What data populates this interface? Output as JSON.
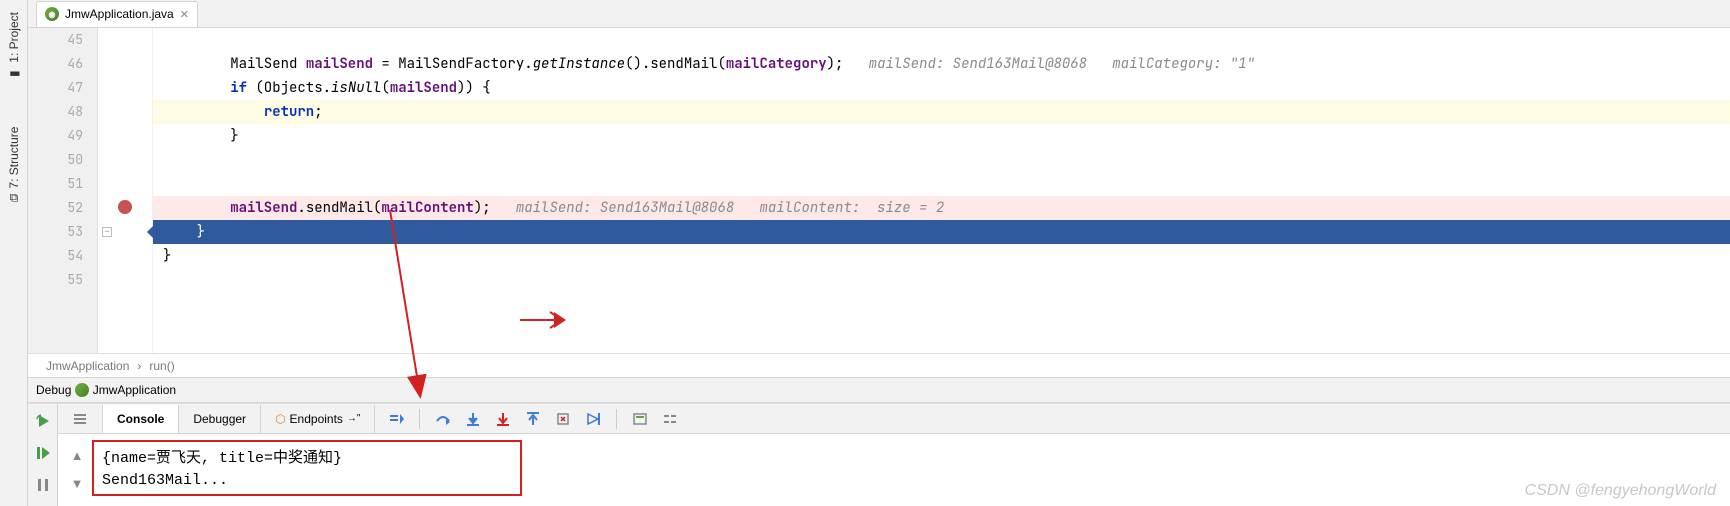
{
  "left_toolbar": {
    "project": "1: Project",
    "structure": "7: Structure"
  },
  "tab": {
    "filename": "JmwApplication.java"
  },
  "gutter": {
    "lines": [
      "45",
      "46",
      "47",
      "48",
      "49",
      "50",
      "51",
      "52",
      "53",
      "54",
      "55"
    ]
  },
  "code": {
    "l46": {
      "type1": "MailSend ",
      "var1": "mailSend",
      "eq": " = ",
      "type2": "MailSendFactory.",
      "m1": "getInstance",
      "p1": "().",
      "m2": "sendMail",
      "p2": "(",
      "var2": "mailCategory",
      "p3": ");",
      "hint": "   mailSend: Send163Mail@8068   mailCategory: \"1\""
    },
    "l47": {
      "kw": "if ",
      "p1": "(Objects.",
      "m1": "isNull",
      "p2": "(",
      "var": "mailSend",
      "p3": ")) {"
    },
    "l48": {
      "kw": "return",
      "semi": ";"
    },
    "l49": "}",
    "l52": {
      "var1": "mailSend",
      "dot": ".",
      "m1": "sendMail",
      "p1": "(",
      "var2": "mailContent",
      "p2": ");",
      "hint": "   mailSend: Send163Mail@8068   mailContent:  size = 2"
    },
    "l53": "    }",
    "l54": "}"
  },
  "breadcrumb": {
    "c1": "JmwApplication",
    "sep": "›",
    "c2": "run()"
  },
  "debug": {
    "label": "Debug",
    "config": "JmwApplication",
    "tabs": {
      "console": "Console",
      "debugger": "Debugger",
      "endpoints": "Endpoints"
    },
    "endpoint_arrow": "→\""
  },
  "console": {
    "line1": "{name=贾飞天, title=中奖通知}",
    "line2": "Send163Mail..."
  },
  "watermark": "CSDN @fengyehongWorld"
}
